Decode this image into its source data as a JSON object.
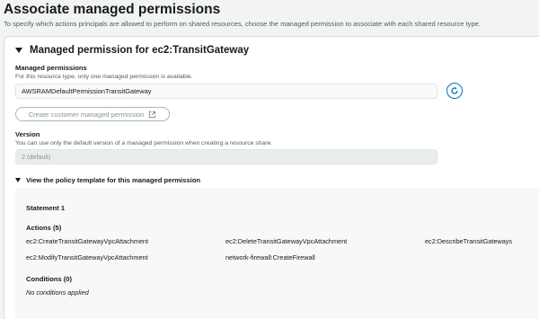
{
  "page": {
    "title": "Associate managed permissions",
    "description": "To specify which actions principals are allowed to perform on shared resources, choose the managed permission to associate with each shared resource type."
  },
  "section": {
    "title": "Managed permission for ec2:TransitGateway"
  },
  "managed_permissions": {
    "label": "Managed permissions",
    "description": "For this resource type, only one managed permission is available.",
    "selected": "AWSRAMDefaultPermissionTransitGateway",
    "create_button_label": "Create customer managed permission"
  },
  "version": {
    "label": "Version",
    "description": "You can use only the default version of a managed permission when creating a resource share.",
    "value": "2 (default)"
  },
  "policy": {
    "toggle_label": "View the policy template for this managed permission",
    "statement_title": "Statement 1",
    "actions_label": "Actions (5)",
    "actions": [
      "ec2:CreateTransitGatewayVpcAttachment",
      "ec2:DeleteTransitGatewayVpcAttachment",
      "ec2:DescribeTransitGateways",
      "ec2:ModifyTransitGatewayVpcAttachment",
      "network-firewall:CreateFirewall"
    ],
    "conditions_label": "Conditions (0)",
    "conditions_value": "No conditions applied"
  },
  "icons": {
    "refresh": "refresh-icon",
    "external": "external-link-icon",
    "caret": "caret-down-icon"
  },
  "colors": {
    "accent": "#0073bb",
    "page_bg": "#f2f3f3",
    "muted_text": "#545b64"
  }
}
